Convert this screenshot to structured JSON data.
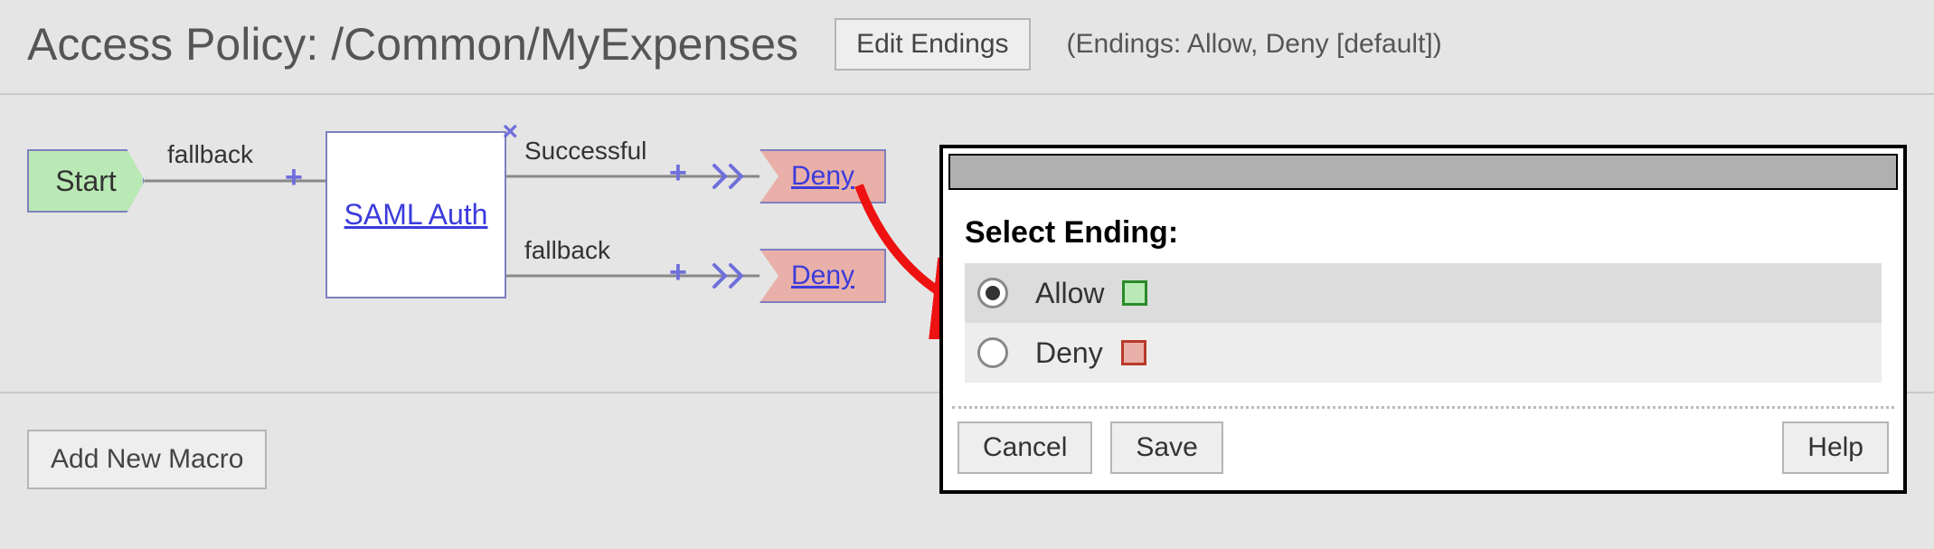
{
  "header": {
    "title": "Access Policy: /Common/MyExpenses",
    "edit_endings_label": "Edit Endings",
    "endings_note": "(Endings: Allow, Deny [default])"
  },
  "flow": {
    "start_label": "Start",
    "start_branch_label": "fallback",
    "saml_node_label": "SAML Auth",
    "branches": [
      {
        "label": "Successful",
        "ending": "Deny"
      },
      {
        "label": "fallback",
        "ending": "Deny"
      }
    ]
  },
  "macro": {
    "add_label": "Add New Macro"
  },
  "dialog": {
    "heading": "Select Ending:",
    "options": [
      {
        "label": "Allow",
        "color": "allow",
        "selected": true
      },
      {
        "label": "Deny",
        "color": "deny",
        "selected": false
      }
    ],
    "buttons": {
      "cancel": "Cancel",
      "save": "Save",
      "help": "Help"
    }
  }
}
